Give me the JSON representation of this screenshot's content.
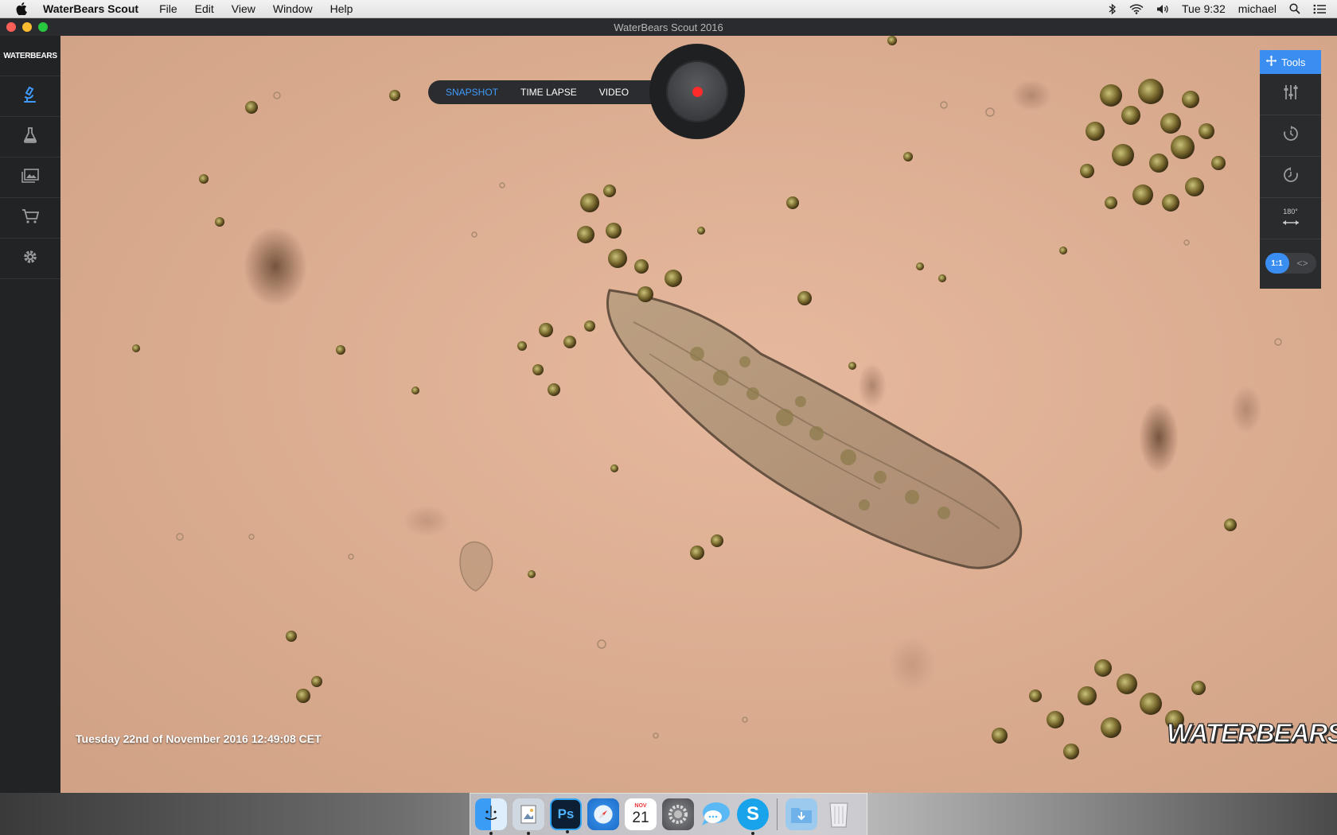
{
  "menubar": {
    "app_name": "WaterBears Scout",
    "items": [
      "File",
      "Edit",
      "View",
      "Window",
      "Help"
    ],
    "clock": "Tue 9:32",
    "user": "michael"
  },
  "window": {
    "title": "WaterBears Scout 2016"
  },
  "sidebar": {
    "logo": "WATERBEARS",
    "items": [
      {
        "icon": "microscope-icon",
        "active": true
      },
      {
        "icon": "flask-icon",
        "active": false
      },
      {
        "icon": "gallery-icon",
        "active": false
      },
      {
        "icon": "cart-icon",
        "active": false
      },
      {
        "icon": "gear-icon",
        "active": false
      }
    ]
  },
  "capture": {
    "tabs": [
      "SNAPSHOT",
      "TIME LAPSE",
      "VIDEO"
    ],
    "active_tab": "SNAPSHOT"
  },
  "tools": {
    "header": "Tools",
    "rotate_label": "180°",
    "zoom_label": "1:1",
    "expand_label": "<>"
  },
  "overlay": {
    "timestamp": "Tuesday 22nd of November 2016 12:49:08 CET",
    "watermark": "WATERBEARS"
  },
  "dock": {
    "apps": [
      "finder-icon",
      "preview-icon",
      "photoshop-icon",
      "safari-icon",
      "calendar-icon",
      "system-preferences-icon",
      "messages-icon",
      "skype-icon",
      "downloads-icon",
      "trash-icon"
    ],
    "photoshop_label": "Ps",
    "calendar_day": "21",
    "calendar_month": "NOV",
    "skype_label": "S"
  },
  "colors": {
    "accent": "#3a8ef2",
    "record": "#ff2a2a",
    "sample_background": "#dcae94"
  }
}
